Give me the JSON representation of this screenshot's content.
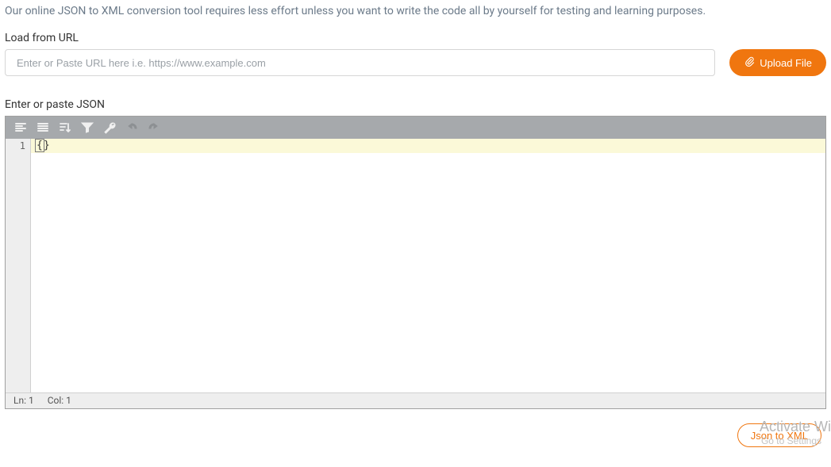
{
  "intro": "Our online JSON to XML conversion tool requires less effort unless you want to write the code all by yourself for testing and learning purposes.",
  "url_section": {
    "label": "Load from URL",
    "placeholder": "Enter or Paste URL here i.e. https://www.example.com",
    "value": ""
  },
  "upload_button": {
    "label": "Upload File"
  },
  "editor": {
    "label": "Enter or paste JSON",
    "toolbar": {
      "items": [
        "format-left-icon",
        "format-compact-icon",
        "sort-icon",
        "filter-icon",
        "repair-icon",
        "undo-icon",
        "redo-icon"
      ]
    },
    "line_number": "1",
    "content": "{}",
    "statusbar": {
      "ln": "Ln: 1",
      "col": "Col: 1"
    }
  },
  "convert_button": {
    "label": "Json to XML"
  },
  "watermark": {
    "title": "Activate Wi",
    "sub": "Go to Settings"
  }
}
